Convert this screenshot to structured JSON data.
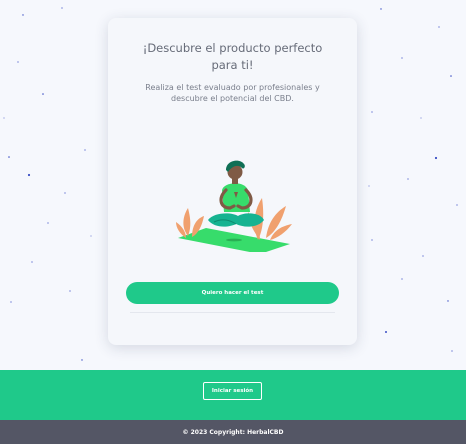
{
  "card": {
    "title": "¡Descubre el producto perfecto para ti!",
    "description": "Realiza el test evaluado por profesionales y descubre el potencial del CBD.",
    "illustration_icon": "meditating-person-illustration",
    "cta_label": "Quiero hacer el test"
  },
  "band": {
    "login_label": "Iniciar sesión"
  },
  "footer": {
    "copyright": "© 2023 Copyright: HerbalCBD"
  },
  "colors": {
    "accent": "#1fc98a",
    "footer": "#545665",
    "background": "#f6f8fd",
    "card": "#f5f7fb",
    "particles": "#3b4fc4"
  }
}
